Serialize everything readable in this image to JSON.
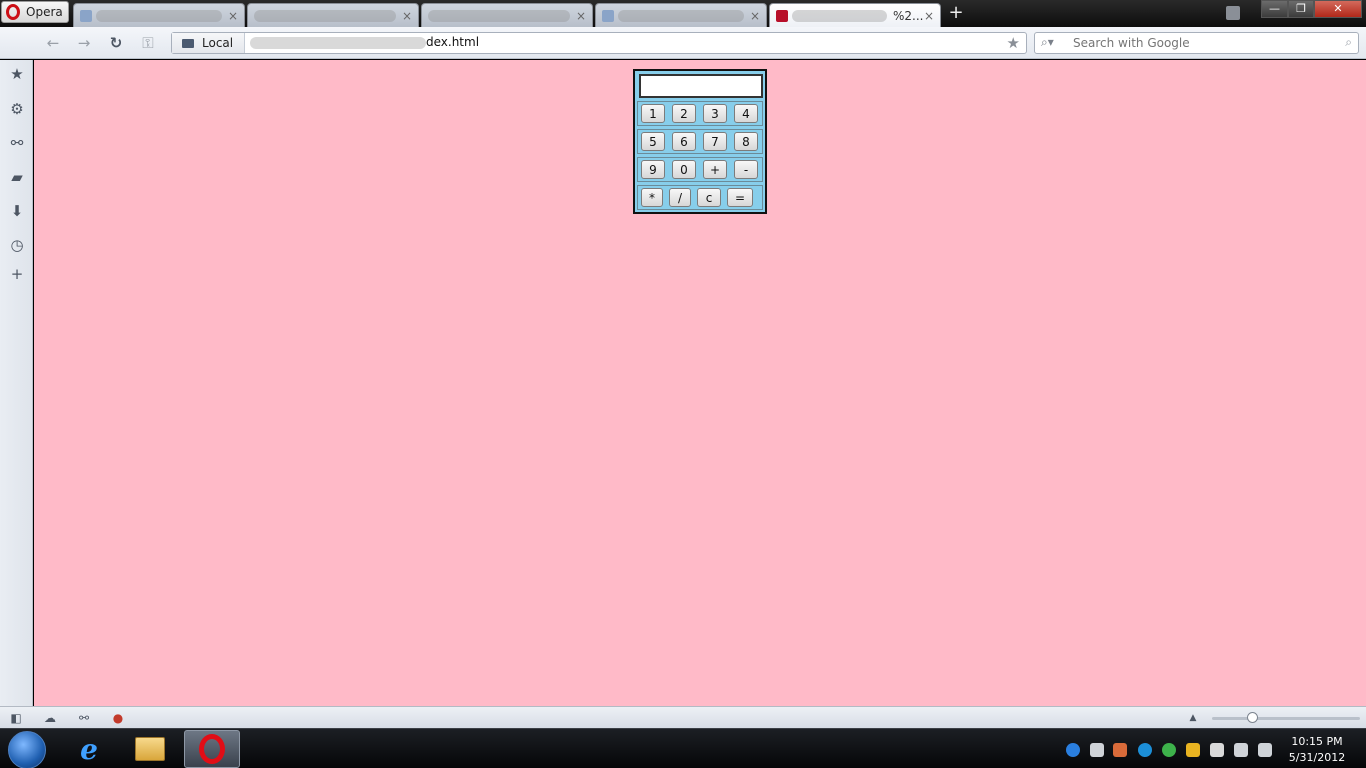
{
  "browser": {
    "menu_label": "Opera",
    "tabs": [
      {
        "title": "",
        "close": "×"
      },
      {
        "title": "",
        "close": "×"
      },
      {
        "title": "",
        "close": "×"
      },
      {
        "title": "",
        "close": "×"
      },
      {
        "title": "%2...",
        "close": "×"
      }
    ],
    "new_tab": "+",
    "window_controls": {
      "minimize": "—",
      "restore": "❐",
      "close": "✕"
    }
  },
  "toolbar": {
    "back": "←",
    "forward": "→",
    "reload": "↻",
    "key": "⚿",
    "location_badge": "Local",
    "url_visible": "dex.html",
    "bookmark_star": "★"
  },
  "search": {
    "placeholder": "Search with Google",
    "lens": "⌕▾",
    "go": "⌕"
  },
  "sidebar": {
    "icons": [
      "bookmarks-icon",
      "settings-icon",
      "unite-icon",
      "notes-icon",
      "downloads-icon",
      "history-icon",
      "add-panel-icon"
    ]
  },
  "calculator": {
    "display_value": "",
    "rows": [
      [
        "1",
        "2",
        "3",
        "4"
      ],
      [
        "5",
        "6",
        "7",
        "8"
      ],
      [
        "9",
        "0",
        "+",
        "-"
      ],
      [
        "*",
        "/",
        "c",
        "="
      ]
    ],
    "background": "#87ceeb"
  },
  "page": {
    "background": "#ffbac8"
  },
  "statusbar": {
    "panel": "◧",
    "turbo": "☁",
    "unite": "⚯",
    "zoom_arrow": "▲"
  },
  "taskbar": {
    "time": "10:15 PM",
    "date": "5/31/2012"
  }
}
